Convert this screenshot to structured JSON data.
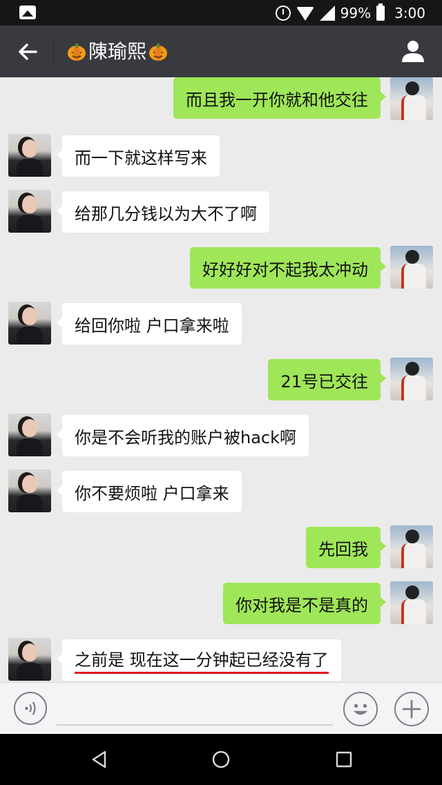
{
  "status_bar": {
    "battery": "99%",
    "time": "3:00",
    "icons": [
      "gallery-icon",
      "alarm-icon",
      "wifi-icon",
      "signal-icon",
      "battery-icon"
    ]
  },
  "header": {
    "title_name": "陳瑜熙",
    "title_emoji": "pumpkin-icon",
    "back_icon": "arrow-left-icon",
    "profile_icon": "person-icon",
    "background": "#393a3f"
  },
  "colors": {
    "chat_background": "#ebebeb",
    "outgoing_bubble": "#9fe658",
    "incoming_bubble": "#ffffff",
    "highlight_underline": "#e0141e"
  },
  "messages": [
    {
      "side": "right",
      "text": "而且我一开你就和他交往"
    },
    {
      "side": "left",
      "text": "而一下就这样写来"
    },
    {
      "side": "left",
      "text": "给那几分钱以为大不了啊"
    },
    {
      "side": "right",
      "text": "好好好对不起我太冲动"
    },
    {
      "side": "left",
      "text": "给回你啦 户口拿来啦"
    },
    {
      "side": "right",
      "text": "21号已交往"
    },
    {
      "side": "left",
      "text": "你是不会听我的账户被hack啊"
    },
    {
      "side": "left",
      "text": "你不要烦啦 户口拿来"
    },
    {
      "side": "right",
      "text": "先回我"
    },
    {
      "side": "right",
      "text": "你对我是不是真的"
    },
    {
      "side": "left",
      "text": "之前是 现在这一分钟起已经没有了",
      "underlined": true
    }
  ],
  "input_bar": {
    "voice_icon": "voice-icon",
    "emoji_icon": "smiley-icon",
    "plus_icon": "plus-icon",
    "placeholder": ""
  },
  "nav_bar": {
    "icons": [
      "back-triangle-icon",
      "home-circle-icon",
      "recents-square-icon"
    ]
  }
}
